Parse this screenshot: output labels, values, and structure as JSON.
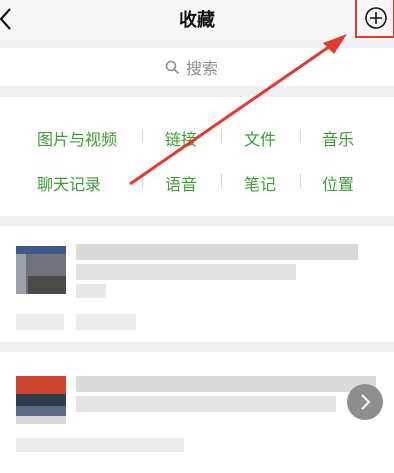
{
  "header": {
    "title": "收藏"
  },
  "search": {
    "placeholder": "搜索"
  },
  "categories": {
    "row1": [
      "图片与视频",
      "链接",
      "文件",
      "音乐"
    ],
    "row2": [
      "聊天记录",
      "语音",
      "笔记",
      "位置"
    ]
  },
  "colors": {
    "accent_green": "#3f9c35",
    "highlight_red": "#e23b2e"
  },
  "icons": {
    "back": "chevron-left-icon",
    "add": "plus-circle-icon",
    "search": "search-icon",
    "next": "chevron-right-icon"
  }
}
